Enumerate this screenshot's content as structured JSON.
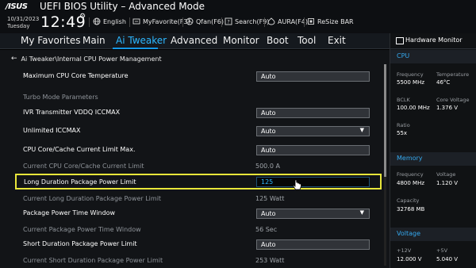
{
  "header": {
    "logo": "/ISUS",
    "title": "UEFI BIOS Utility – Advanced Mode",
    "date": "10/31/2023",
    "day": "Tuesday",
    "time": "12:49",
    "items": [
      {
        "icon": "globe-icon",
        "label": "English"
      },
      {
        "icon": "favorite-icon",
        "label": "MyFavorite(F3)"
      },
      {
        "icon": "fan-icon",
        "label": "Qfan(F6)"
      },
      {
        "icon": "help-search-icon",
        "label": "Search(F9)"
      },
      {
        "icon": "aura-icon",
        "label": "AURA(F4)"
      },
      {
        "icon": "resize-bar-icon",
        "label": "ReSize BAR"
      }
    ]
  },
  "menu": {
    "tabs": [
      "My Favorites",
      "Main",
      "Ai Tweaker",
      "Advanced",
      "Monitor",
      "Boot",
      "Tool",
      "Exit"
    ],
    "active": "Ai Tweaker"
  },
  "breadcrumb": "Ai Tweaker\\Internal CPU Power Management",
  "rows": [
    {
      "label": "Maximum CPU Core Temperature",
      "kind": "field",
      "value": "Auto"
    },
    {
      "label": "Turbo Mode Parameters",
      "kind": "section"
    },
    {
      "label": "IVR Transmitter VDDQ ICCMAX",
      "kind": "field",
      "value": "Auto"
    },
    {
      "label": "Unlimited ICCMAX",
      "kind": "select",
      "value": "Auto"
    },
    {
      "label": "CPU Core/Cache Current Limit Max.",
      "kind": "field",
      "value": "Auto"
    },
    {
      "label": "Current CPU Core/Cache Current Limit",
      "kind": "readonly",
      "value": "500.0 A"
    },
    {
      "label": "Long Duration Package Power Limit",
      "kind": "field",
      "value": "125",
      "selected": true
    },
    {
      "label": "Current Long Duration Package Power Limit",
      "kind": "readonly",
      "value": "125 Watt"
    },
    {
      "label": "Package Power Time Window",
      "kind": "select",
      "value": "Auto"
    },
    {
      "label": "Current Package Power Time Window",
      "kind": "readonly",
      "value": "56 Sec"
    },
    {
      "label": "Short Duration Package Power Limit",
      "kind": "field",
      "value": "Auto"
    },
    {
      "label": "Current Short Duration Package Power Limit",
      "kind": "readonly",
      "value": "253 Watt"
    }
  ],
  "hardware_monitor": {
    "title": "Hardware Monitor",
    "cpu": {
      "section": "CPU",
      "frequency_label": "Frequency",
      "frequency": "5500 MHz",
      "temperature_label": "Temperature",
      "temperature": "46°C",
      "bclk_label": "BCLK",
      "bclk": "100.00 MHz",
      "core_voltage_label": "Core Voltage",
      "core_voltage": "1.376 V",
      "ratio_label": "Ratio",
      "ratio": "55x"
    },
    "memory": {
      "section": "Memory",
      "frequency_label": "Frequency",
      "frequency": "4800 MHz",
      "voltage_label": "Voltage",
      "voltage": "1.120 V",
      "capacity_label": "Capacity",
      "capacity": "32768 MB"
    },
    "voltage": {
      "section": "Voltage",
      "v12_label": "+12V",
      "v12": "12.000 V",
      "v5_label": "+5V",
      "v5": "5.040 V"
    }
  },
  "colors": {
    "accent": "#2db7ff",
    "highlight_border": "#e8e63a",
    "background": "#121417"
  }
}
